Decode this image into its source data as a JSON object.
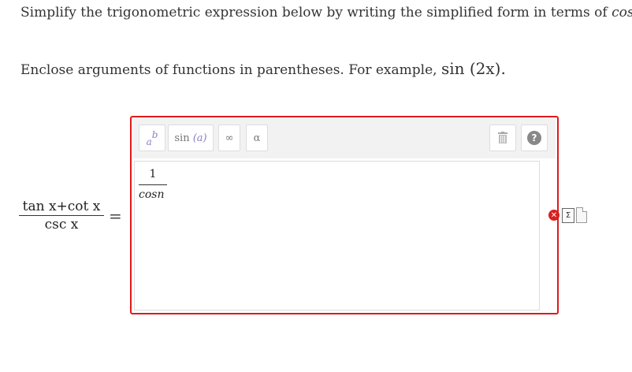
{
  "question": {
    "line1_text": "Simplify the trigonometric expression below by writing the simplified form in terms of",
    "line1_math": "cos x.",
    "line2_text": "Enclose arguments of functions in parentheses. For example,",
    "line2_math": "sin (2x)."
  },
  "lhs": {
    "numerator": "tan x+cot x",
    "denominator": "csc x",
    "equals": "="
  },
  "toolbar": {
    "power_base": "a",
    "power_exp": "b",
    "sin_label": "sin",
    "sin_arg": "(a)",
    "infinity": "∞",
    "alpha": "α",
    "help": "?"
  },
  "answer": {
    "numerator": "1",
    "denominator": "cosn"
  },
  "status": {
    "error_mark": "✕",
    "sum_symbol": "Σ"
  },
  "colors": {
    "error_border": "#e0191b",
    "toolbar_bg": "#f2f2f2",
    "accent_purple": "#8a7fc7"
  }
}
